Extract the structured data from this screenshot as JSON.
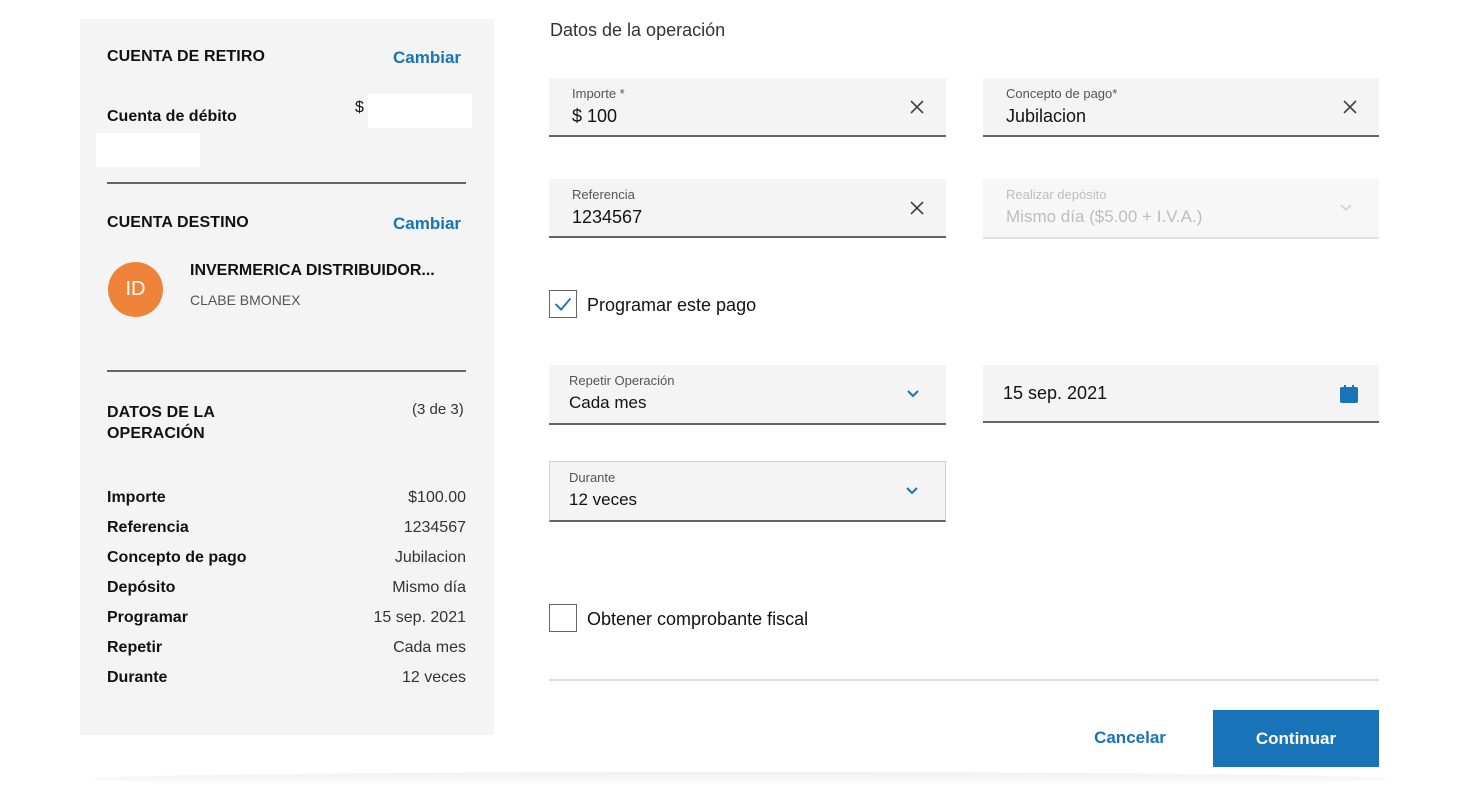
{
  "colors": {
    "accent": "#1973b8",
    "avatar": "#f0833a",
    "panel": "#f4f4f4"
  },
  "summary": {
    "withdraw": {
      "title": "CUENTA DE RETIRO",
      "change": "Cambiar",
      "account_label": "Cuenta de débito",
      "currency": "$"
    },
    "destination": {
      "title": "CUENTA DESTINO",
      "change": "Cambiar",
      "initials": "ID",
      "name": "INVERMERICA DISTRIBUIDOR...",
      "subtitle": "CLABE BMONEX"
    },
    "operation": {
      "title_line1": "DATOS DE LA",
      "title_line2": "OPERACIÓN",
      "step": "(3 de 3)",
      "rows": [
        {
          "key": "Importe",
          "value": "$100.00"
        },
        {
          "key": "Referencia",
          "value": "1234567"
        },
        {
          "key": "Concepto de pago",
          "value": "Jubilacion"
        },
        {
          "key": "Depósito",
          "value": "Mismo día"
        },
        {
          "key": "Programar",
          "value": "15 sep. 2021"
        },
        {
          "key": "Repetir",
          "value": "Cada mes"
        },
        {
          "key": "Durante",
          "value": "12 veces"
        }
      ]
    }
  },
  "form": {
    "title": "Datos de la operación",
    "amount": {
      "label": "Importe *",
      "value": "$ 100",
      "icon": "close-icon"
    },
    "concept": {
      "label": "Concepto de pago*",
      "value": "Jubilacion",
      "icon": "close-icon"
    },
    "reference": {
      "label": "Referencia",
      "value": "1234567",
      "icon": "close-icon"
    },
    "deposit": {
      "label": "Realizar depósito",
      "value": "Mismo día ($5.00 + I.V.A.)",
      "icon": "chevron-down-icon"
    },
    "schedule": {
      "label": "Programar este pago",
      "checked": true
    },
    "repeat": {
      "label": "Repetir Operación",
      "value": "Cada mes",
      "icon": "chevron-down-icon"
    },
    "date": {
      "value": "15 sep. 2021",
      "icon": "calendar-icon"
    },
    "duration": {
      "label": "Durante",
      "value": "12 veces",
      "icon": "chevron-down-icon"
    },
    "invoice": {
      "label": "Obtener comprobante fiscal",
      "checked": false
    }
  },
  "actions": {
    "cancel": "Cancelar",
    "continue": "Continuar"
  }
}
